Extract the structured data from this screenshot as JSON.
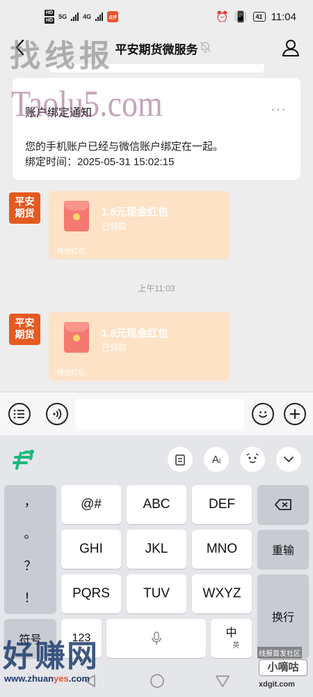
{
  "status_bar": {
    "hd1": "HD",
    "hd2": "HD",
    "net1": "5G",
    "net2": "4G",
    "app_badge": "点评",
    "battery": "41",
    "time": "11:04"
  },
  "nav": {
    "title": "平安期货微服务",
    "back_icon": "chevron-left-icon",
    "mute_icon": "bell-off-icon",
    "profile_icon": "person-icon"
  },
  "notice_card": {
    "title": "账户绑定通知",
    "more": "···",
    "line1": "您的手机账户已经与微信账户绑定在一起。",
    "line2": "绑定时间：2025-05-31 15:02:15"
  },
  "messages": [
    {
      "avatar_line1": "平安",
      "avatar_line2": "期货",
      "packet_title": "1.8元现金红包",
      "packet_status": "已领取",
      "packet_footer": "微信红包"
    },
    {
      "avatar_line1": "平安",
      "avatar_line2": "期货",
      "packet_title": "1.8元现金红包",
      "packet_status": "已领取",
      "packet_footer": "微信红包"
    }
  ],
  "timestamp": "上午11:03",
  "input_bar": {
    "left1_icon": "list-icon",
    "left2_icon": "voice-icon",
    "emoji_icon": "emoji-icon",
    "plus_icon": "plus-icon"
  },
  "keyboard": {
    "toolbar": {
      "clipboard_icon": "clipboard-icon",
      "font_label": "Aᵢ",
      "sticker_icon": "sticker-face-icon",
      "collapse_icon": "chevron-down-icon"
    },
    "punctuation": [
      "，",
      "。",
      "？",
      "！"
    ],
    "keys_row1": [
      "@#",
      "ABC",
      "DEF"
    ],
    "keys_row2": [
      "GHI",
      "JKL",
      "MNO"
    ],
    "keys_row3": [
      "PQRS",
      "TUV",
      "WXYZ"
    ],
    "delete_icon": "backspace-icon",
    "reenter": "重输",
    "enter": "换行",
    "symbols": "符号",
    "num": "123",
    "lang_main": "中",
    "lang_sub": "英"
  },
  "watermarks": {
    "top": "找线报",
    "taolu": "Taolu5.com",
    "bottom_left": "好赚网",
    "bottom_left_url_a": "www.zhuan",
    "bottom_left_url_b": "yes",
    "bottom_left_url_c": ".com",
    "br1": "线报首发社区",
    "br2": "小嘀咕",
    "br3": "xdgit.com"
  },
  "colors": {
    "brand_orange": "#e55a21",
    "packet_bg": "#fde2c6",
    "chat_bg": "#ededed"
  }
}
